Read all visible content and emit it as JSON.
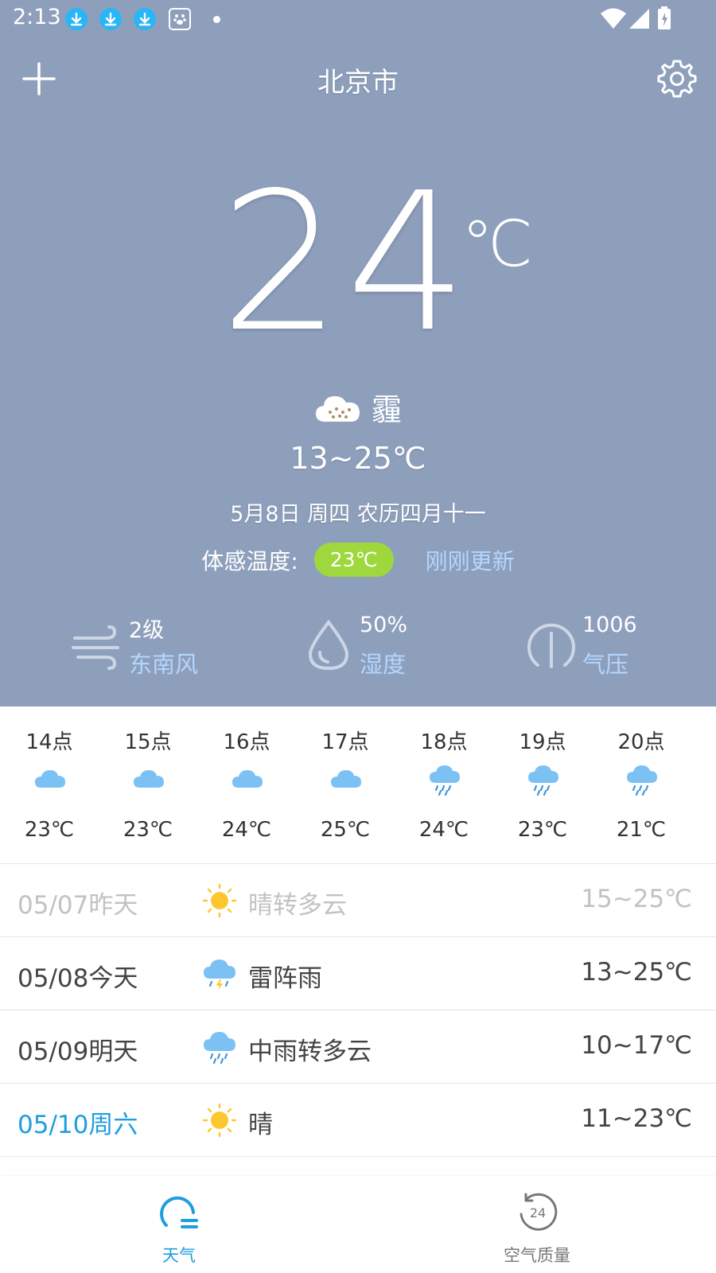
{
  "status_bar": {
    "time": "2:13",
    "icons": [
      "download-icon",
      "download-icon",
      "download-icon",
      "paw-icon",
      "dot-icon",
      "wifi-icon",
      "signal-icon",
      "battery-icon"
    ]
  },
  "header": {
    "city": "北京市",
    "add_icon": "plus-icon",
    "settings_icon": "gear-icon"
  },
  "current": {
    "temperature": "24",
    "unit": "℃",
    "condition": "霾",
    "condition_icon": "haze-icon",
    "range": "13~25℃",
    "date_line": "5月8日 周四 农历四月十一",
    "feel_label": "体感温度:",
    "feel_value": "23℃",
    "updated": "刚刚更新"
  },
  "stats": {
    "wind": {
      "value": "2级",
      "label": "东南风",
      "icon": "wind-icon"
    },
    "humidity": {
      "value": "50%",
      "label": "湿度",
      "icon": "droplet-icon"
    },
    "pressure": {
      "value": "1006",
      "label": "气压",
      "icon": "gauge-icon"
    }
  },
  "hourly": [
    {
      "hour": "14点",
      "temp": "23℃",
      "icon": "cloud-icon"
    },
    {
      "hour": "15点",
      "temp": "23℃",
      "icon": "cloud-icon"
    },
    {
      "hour": "16点",
      "temp": "24℃",
      "icon": "cloud-icon"
    },
    {
      "hour": "17点",
      "temp": "25℃",
      "icon": "cloud-icon"
    },
    {
      "hour": "18点",
      "temp": "24℃",
      "icon": "rain-cloud-icon"
    },
    {
      "hour": "19点",
      "temp": "23℃",
      "icon": "rain-cloud-icon"
    },
    {
      "hour": "20点",
      "temp": "21℃",
      "icon": "rain-cloud-icon"
    }
  ],
  "daily": [
    {
      "date": "05/07昨天",
      "condition": "晴转多云",
      "range": "15~25℃",
      "icon": "sun-icon",
      "state": "past"
    },
    {
      "date": "05/08今天",
      "condition": "雷阵雨",
      "range": "13~25℃",
      "icon": "thunderstorm-icon",
      "state": "normal"
    },
    {
      "date": "05/09明天",
      "condition": "中雨转多云",
      "range": "10~17℃",
      "icon": "rain-cloud-icon",
      "state": "normal"
    },
    {
      "date": "05/10周六",
      "condition": "晴",
      "range": "11~23℃",
      "icon": "sun-icon",
      "state": "highlight"
    }
  ],
  "bottom_nav": {
    "weather_label": "天气",
    "aqi_label": "空气质量",
    "weather_icon": "weather-gauge-icon",
    "aqi_icon": "clock-24-icon",
    "active_color": "#1e9ee0",
    "inactive_color": "#777777"
  },
  "colors": {
    "hero_background": "#8e9fbc",
    "feel_badge": "#9ed83c",
    "link_blue": "#b3d7ff",
    "accent_blue": "#1e9ee0",
    "cloud_blue": "#7cc1f4",
    "sun_yellow": "#fdc82f"
  }
}
